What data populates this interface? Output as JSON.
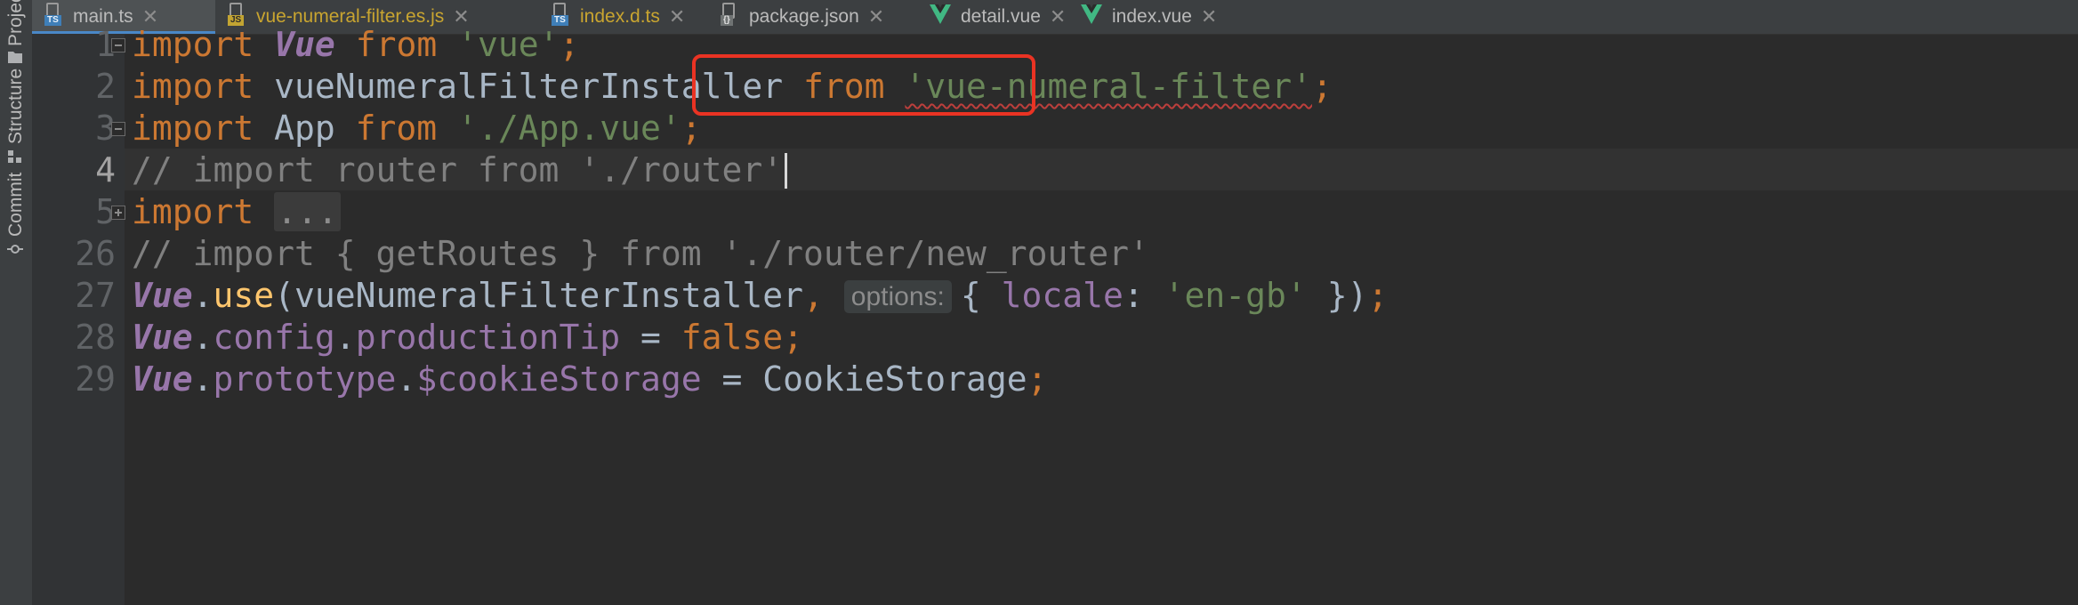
{
  "sidebar": {
    "items": [
      {
        "label": "Project",
        "icon": "folder-icon"
      },
      {
        "label": "Structure",
        "icon": "structure-icon"
      },
      {
        "label": "Commit",
        "icon": "commit-icon"
      }
    ]
  },
  "tabs": [
    {
      "label": "main.ts",
      "icon": "ts-file-icon",
      "badge": "TS",
      "active": true
    },
    {
      "label": "vue-numeral-filter.es.js",
      "icon": "js-file-icon",
      "badge": "JS",
      "active": false
    },
    {
      "label": "index.d.ts",
      "icon": "ts-file-icon",
      "badge": "TS",
      "active": false
    },
    {
      "label": "package.json",
      "icon": "json-file-icon",
      "badge": "{}",
      "active": false
    },
    {
      "label": "detail.vue",
      "icon": "vue-file-icon",
      "active": false
    },
    {
      "label": "index.vue",
      "icon": "vue-file-icon",
      "active": false
    }
  ],
  "editor": {
    "current_line": "4",
    "lines": [
      {
        "number": "1",
        "tokens": [
          {
            "t": "import",
            "c": "kw"
          },
          {
            "t": " "
          },
          {
            "t": "Vue",
            "c": "cls"
          },
          {
            "t": " "
          },
          {
            "t": "from",
            "c": "kw"
          },
          {
            "t": " "
          },
          {
            "t": "'vue'",
            "c": "str"
          },
          {
            "t": ";",
            "c": "kw"
          }
        ]
      },
      {
        "number": "2",
        "tokens": [
          {
            "t": "import",
            "c": "kw"
          },
          {
            "t": " vueNumeralFilterInstaller "
          },
          {
            "t": "from",
            "c": "kw"
          },
          {
            "t": " "
          },
          {
            "t": "'vue-numeral-filter'",
            "c": "str err"
          },
          {
            "t": ";",
            "c": "kw"
          }
        ]
      },
      {
        "number": "3",
        "tokens": [
          {
            "t": "import",
            "c": "kw"
          },
          {
            "t": " App "
          },
          {
            "t": "from",
            "c": "kw"
          },
          {
            "t": " "
          },
          {
            "t": "'./App.vue'",
            "c": "str"
          },
          {
            "t": ";",
            "c": "kw"
          }
        ]
      },
      {
        "number": "4",
        "tokens": [
          {
            "t": "// import router from './router'",
            "c": "cmt"
          }
        ]
      },
      {
        "number": "5",
        "tokens": [
          {
            "t": "import",
            "c": "kw"
          },
          {
            "t": " "
          },
          {
            "t": "...",
            "c": "folded"
          }
        ]
      },
      {
        "number": "26",
        "tokens": [
          {
            "t": "// import { getRoutes } from './router/new_router'",
            "c": "cmt"
          }
        ]
      },
      {
        "number": "27",
        "tokens": [
          {
            "t": "Vue",
            "c": "cls"
          },
          {
            "t": "."
          },
          {
            "t": "use",
            "c": "fn"
          },
          {
            "t": "(vueNumeralFilterInstaller"
          },
          {
            "t": ",",
            "c": "kw"
          },
          {
            "t": " "
          },
          {
            "t": "options:",
            "c": "hint"
          },
          {
            "t": "{ "
          },
          {
            "t": "locale",
            "c": "prop"
          },
          {
            "t": ": "
          },
          {
            "t": "'en-gb'",
            "c": "str"
          },
          {
            "t": " })"
          },
          {
            "t": ";",
            "c": "kw"
          }
        ]
      },
      {
        "number": "28",
        "tokens": [
          {
            "t": "Vue",
            "c": "cls"
          },
          {
            "t": "."
          },
          {
            "t": "config",
            "c": "prop"
          },
          {
            "t": "."
          },
          {
            "t": "productionTip",
            "c": "prop"
          },
          {
            "t": " = "
          },
          {
            "t": "false",
            "c": "kw"
          },
          {
            "t": ";",
            "c": "kw"
          }
        ]
      },
      {
        "number": "29",
        "tokens": [
          {
            "t": "Vue",
            "c": "cls"
          },
          {
            "t": "."
          },
          {
            "t": "prototype",
            "c": "prop"
          },
          {
            "t": "."
          },
          {
            "t": "$cookieStorage",
            "c": "prop"
          },
          {
            "t": " = CookieStorage"
          },
          {
            "t": ";",
            "c": "kw"
          }
        ]
      }
    ]
  },
  "colors": {
    "keyword": "#cc7832",
    "string": "#6a8759",
    "comment": "#808080",
    "class": "#9876aa",
    "function": "#ffc66d",
    "highlight_box": "#ea3323"
  }
}
